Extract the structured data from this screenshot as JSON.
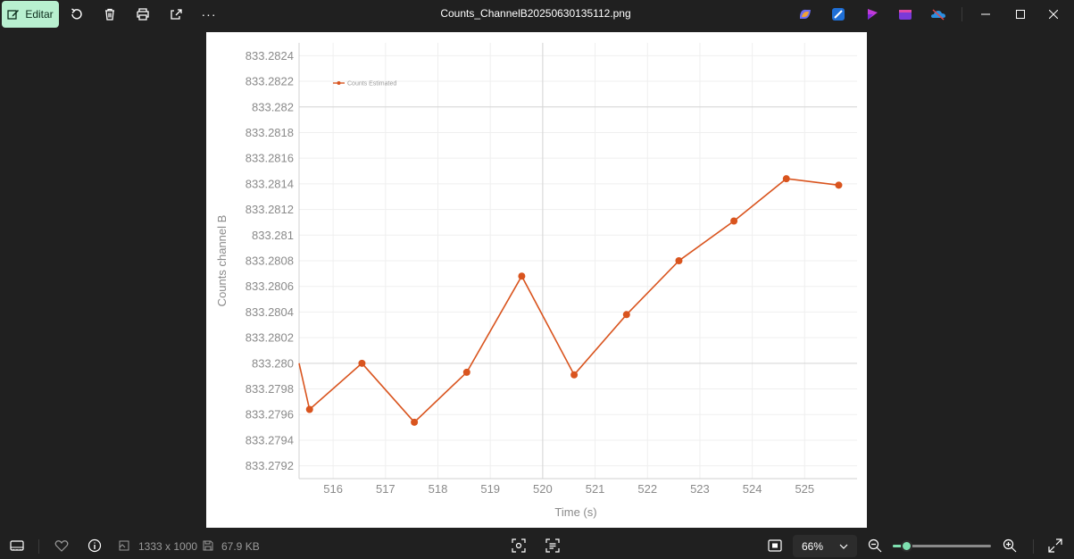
{
  "toolbar": {
    "edit_label": "Editar",
    "more_label": "···",
    "title": "Counts_ChannelB20250630135112.png"
  },
  "status": {
    "dimensions": "1333 x 1000",
    "file_size": "67.9 KB",
    "zoom": "66%",
    "zoom_level": 0.14
  },
  "colors": {
    "accent": "#b8f0d0",
    "slider": "#7ee0b0",
    "series": "#d9541e",
    "background": "#202020"
  },
  "chart_data": {
    "type": "line",
    "title": "",
    "xlabel": "Time (s)",
    "ylabel": "Counts channel B",
    "xlim": [
      515.35,
      526.0
    ],
    "ylim": [
      833.2791,
      833.2825
    ],
    "x_ticks": [
      516,
      517,
      518,
      519,
      520,
      521,
      522,
      523,
      524,
      525
    ],
    "x_tick_labels": [
      "516",
      "517",
      "518",
      "519",
      "520",
      "521",
      "522",
      "523",
      "524",
      "525"
    ],
    "y_ticks": [
      833.2792,
      833.2794,
      833.2796,
      833.2798,
      833.28,
      833.2802,
      833.2804,
      833.2806,
      833.2808,
      833.281,
      833.2812,
      833.2814,
      833.2816,
      833.2818,
      833.282,
      833.2822,
      833.2824
    ],
    "y_tick_labels": [
      "833.2792",
      "833.2794",
      "833.2796",
      "833.2798",
      "833.280",
      "833.2802",
      "833.2804",
      "833.2806",
      "833.2808",
      "833.281",
      "833.2812",
      "833.2814",
      "833.2816",
      "833.2818",
      "833.282",
      "833.2822",
      "833.2824"
    ],
    "grid": true,
    "legend_position": "top-left",
    "series": [
      {
        "name": "Counts Estimated",
        "color": "#d9541e",
        "x": [
          515.35,
          515.55,
          516.55,
          517.55,
          518.55,
          519.6,
          520.6,
          521.6,
          522.6,
          523.65,
          524.65,
          525.65
        ],
        "y": [
          833.28,
          833.27964,
          833.28,
          833.27954,
          833.27993,
          833.28068,
          833.27991,
          833.28038,
          833.2808,
          833.28111,
          833.28144,
          833.28139
        ],
        "markers": [
          false,
          true,
          true,
          true,
          true,
          true,
          true,
          true,
          true,
          true,
          true,
          true
        ]
      }
    ]
  }
}
